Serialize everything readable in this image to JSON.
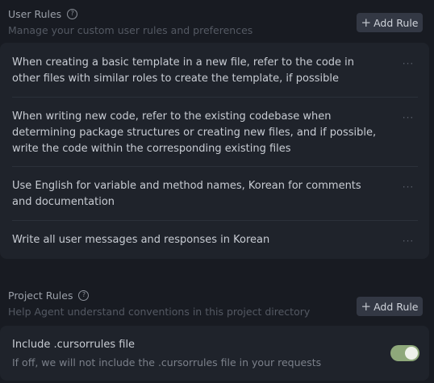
{
  "user_rules": {
    "title": "User Rules",
    "help_icon": "?",
    "subtitle": "Manage your custom user rules and preferences",
    "add_button": {
      "plus": "+",
      "label": "Add Rule"
    },
    "rules": [
      {
        "text": "When creating a basic template in a new file, refer to the code in other files with similar roles to create the template, if possible"
      },
      {
        "text": "When writing new code, refer to the existing codebase when determining package structures or creating new files, and if possible, write the code within the corresponding existing files"
      },
      {
        "text": "Use English for variable and method names, Korean for comments and documentation"
      },
      {
        "text": "Write all user messages and responses in Korean"
      }
    ],
    "more_glyph": "···"
  },
  "project_rules": {
    "title": "Project Rules",
    "help_icon": "?",
    "subtitle": "Help Agent understand conventions in this project directory",
    "add_button": {
      "plus": "+",
      "label": "Add Rule"
    },
    "include": {
      "title": "Include .cursorrules file",
      "description": "If off, we will not include the .cursorrules file in your requests",
      "enabled": true
    }
  },
  "colors": {
    "background": "#181b22",
    "panel": "#1f232b",
    "button": "#333844",
    "toggle_on": "#8ea87a"
  }
}
